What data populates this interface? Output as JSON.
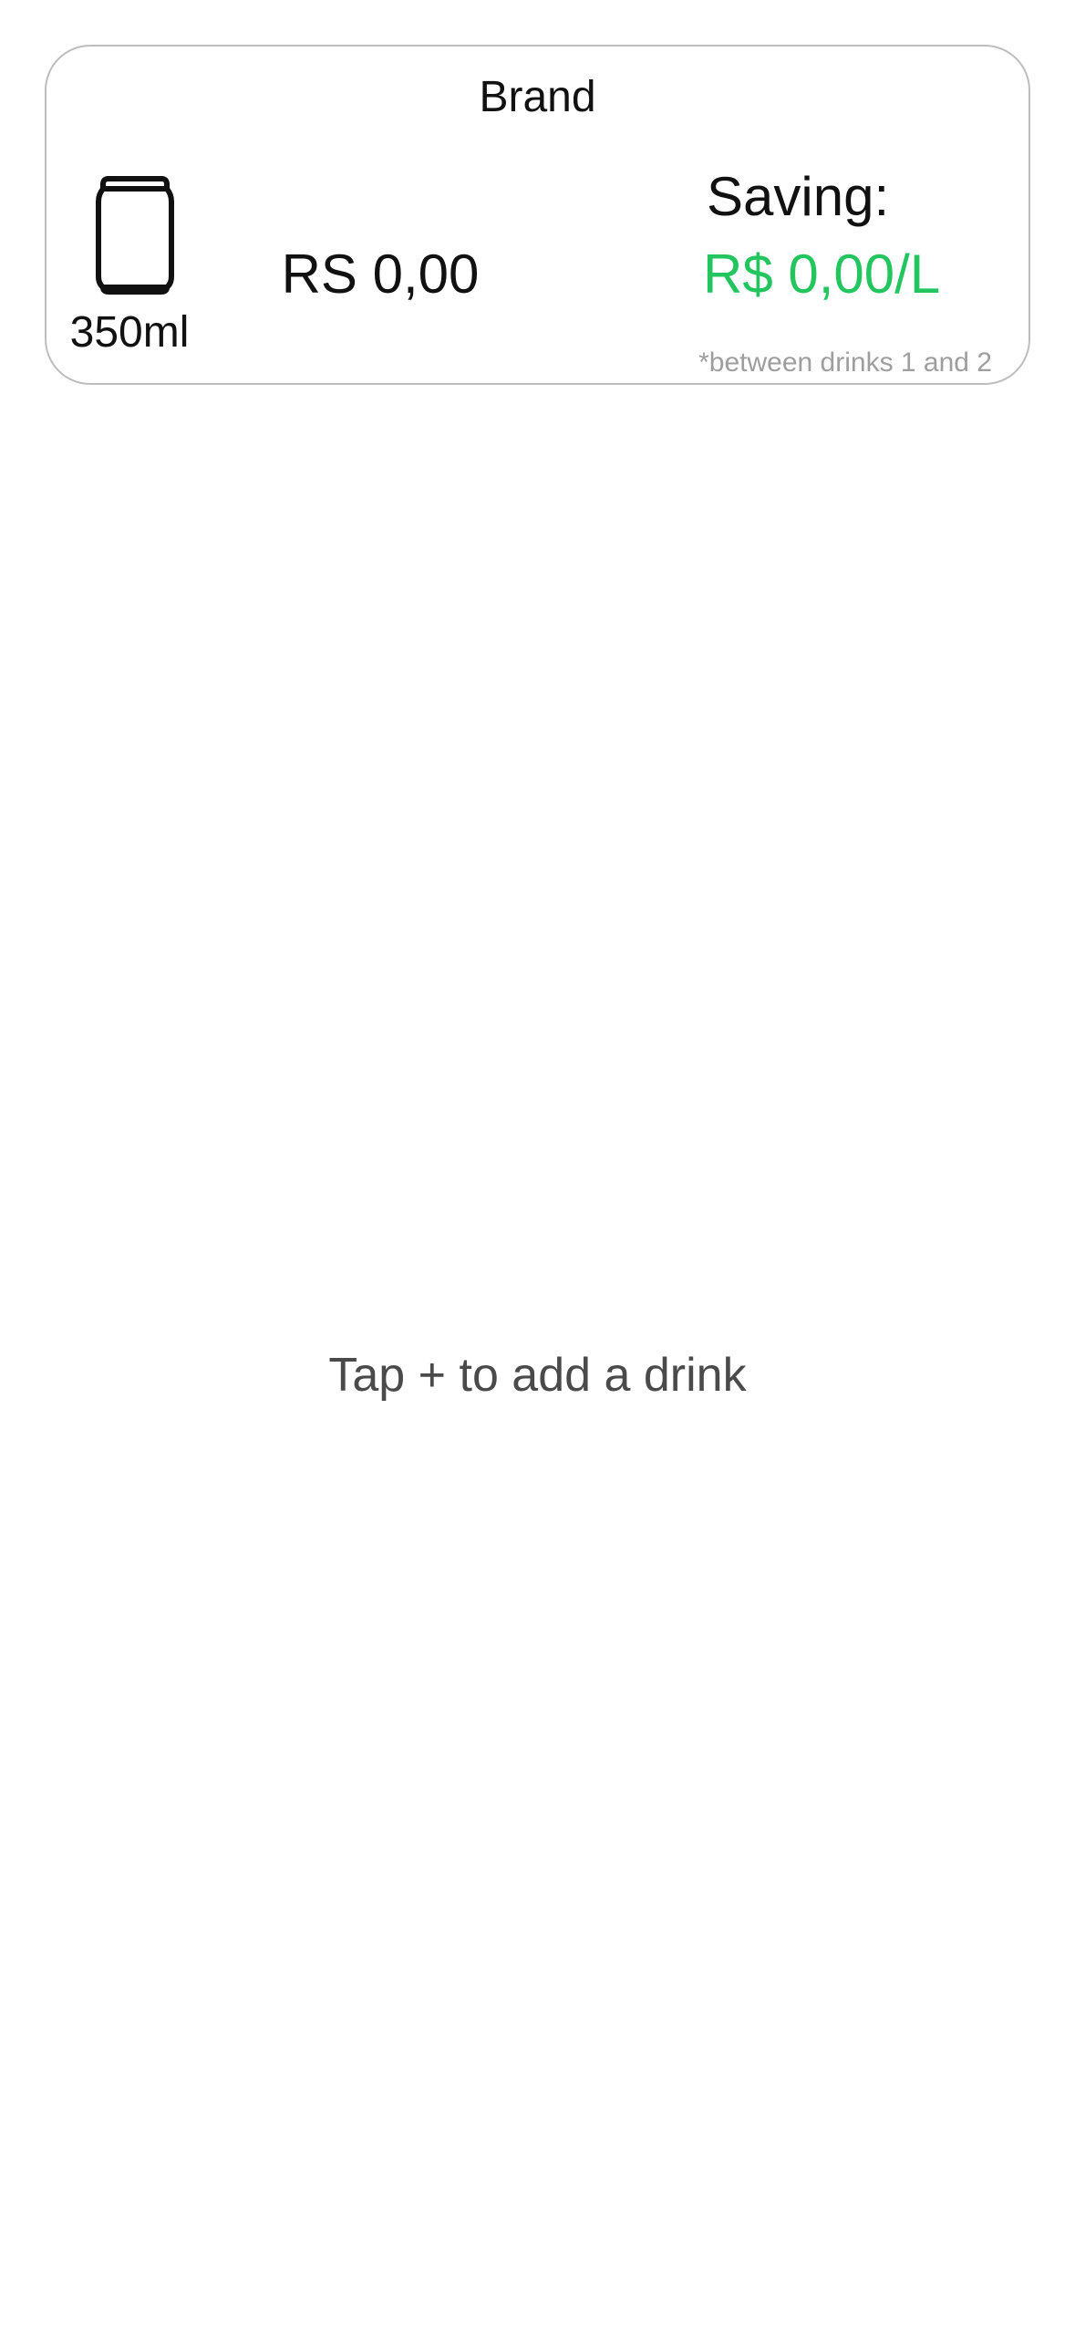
{
  "card": {
    "brand": "Brand",
    "volume": "350ml",
    "price": "RS 0,00",
    "saving_label": "Saving:",
    "saving_value": "R$ 0,00/L",
    "footnote": "*between drinks 1 and 2",
    "icon": "can-icon",
    "accent_color": "#22c55e"
  },
  "empty_state": {
    "hint": "Tap + to add a drink"
  }
}
